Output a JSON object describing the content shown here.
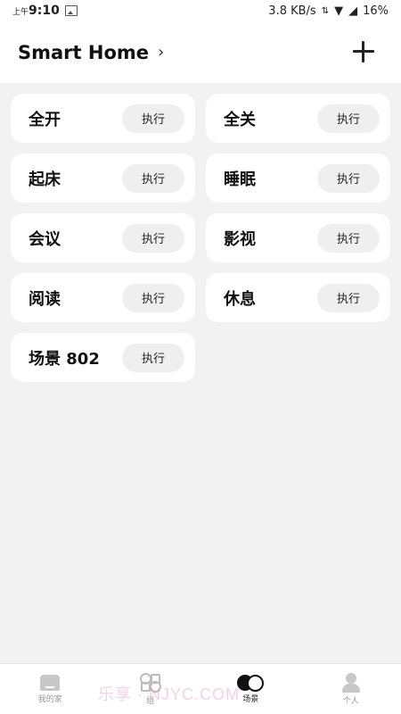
{
  "status_bar": {
    "time_prefix": "上午",
    "time": "9:10",
    "speed": "3.8 KB/s",
    "battery": "16%"
  },
  "header": {
    "title": "Smart Home",
    "chevron": "›"
  },
  "scenes": [
    {
      "name": "全开",
      "action": "执行"
    },
    {
      "name": "全关",
      "action": "执行"
    },
    {
      "name": "起床",
      "action": "执行"
    },
    {
      "name": "睡眠",
      "action": "执行"
    },
    {
      "name": "会议",
      "action": "执行"
    },
    {
      "name": "影视",
      "action": "执行"
    },
    {
      "name": "阅读",
      "action": "执行"
    },
    {
      "name": "休息",
      "action": "执行"
    },
    {
      "name": "场景 802",
      "action": "执行"
    }
  ],
  "nav": {
    "items": [
      {
        "label": "我的家",
        "icon": "home-icon"
      },
      {
        "label": "组",
        "icon": "group-icon"
      },
      {
        "label": "场景",
        "icon": "scene-icon"
      },
      {
        "label": "个人",
        "icon": "person-icon"
      }
    ],
    "active": "场景"
  },
  "watermark": "乐享 · NJYC.COM"
}
